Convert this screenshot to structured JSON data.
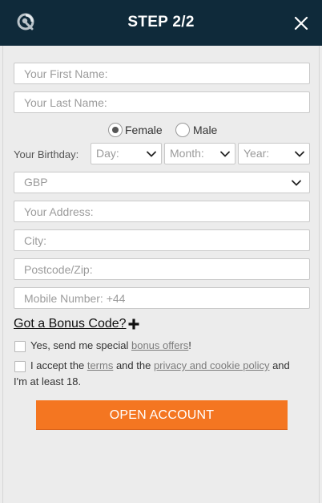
{
  "header": {
    "title": "STEP 2/2",
    "logo_icon": "logo-icon",
    "close_icon": "close-icon"
  },
  "form": {
    "first_name": {
      "placeholder": "Your First Name:",
      "value": ""
    },
    "last_name": {
      "placeholder": "Your Last Name:",
      "value": ""
    },
    "gender": {
      "options": [
        "Female",
        "Male"
      ],
      "selected": "Female"
    },
    "birthday": {
      "label": "Your Birthday:",
      "day": "Day:",
      "month": "Month:",
      "year": "Year:"
    },
    "currency": {
      "selected": "GBP"
    },
    "address": {
      "placeholder": "Your Address:",
      "value": ""
    },
    "city": {
      "placeholder": "City:",
      "value": ""
    },
    "postcode": {
      "placeholder": "Postcode/Zip:",
      "value": ""
    },
    "mobile": {
      "placeholder": "Mobile Number: +44",
      "value": ""
    },
    "bonus_code": {
      "label": "Got a Bonus Code?"
    },
    "offers_checkbox": {
      "pre": "Yes, send me special ",
      "link": "bonus offers",
      "post": "!"
    },
    "terms_checkbox": {
      "pre": "I accept the ",
      "terms_link": "terms",
      "mid": " and the ",
      "privacy_link": "privacy and cookie policy",
      "post": " and",
      "line2": "I'm at least 18."
    },
    "submit_label": "OPEN ACCOUNT"
  },
  "colors": {
    "header_bg": "#0f2a3a",
    "accent": "#f47621",
    "panel_bg": "#ececec"
  }
}
